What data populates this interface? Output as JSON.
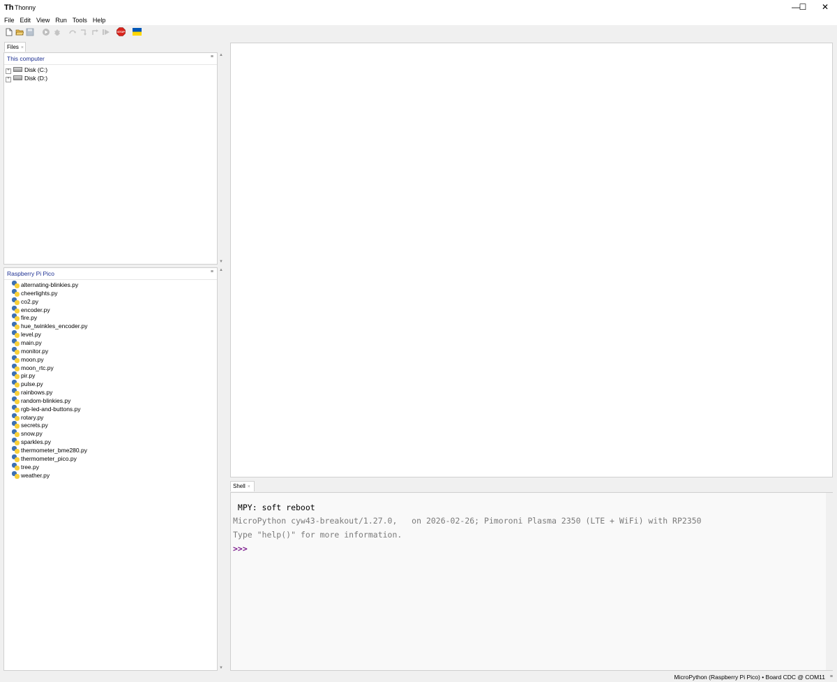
{
  "window": {
    "title": "Thonny",
    "app_icon": "Th",
    "controls": {
      "minimize": "—",
      "maximize": "☐",
      "close": "✕"
    }
  },
  "menubar": [
    "File",
    "Edit",
    "View",
    "Run",
    "Tools",
    "Help"
  ],
  "toolbar": {
    "icons": [
      "new-file-icon",
      "open-file-icon",
      "save-file-icon",
      "run-icon",
      "debug-icon",
      "step-over-icon",
      "step-into-icon",
      "step-out-icon",
      "resume-icon",
      "stop-icon",
      "ukraine-flag-icon"
    ],
    "stop_label": "STOP",
    "stop_color": "#d9241c",
    "flag_colors": [
      "#0057b7",
      "#ffd700"
    ]
  },
  "files_panel": {
    "tab_label": "Files",
    "close_glyph": "×",
    "menu_glyph": "≡",
    "this_computer": {
      "title": "This computer",
      "drives": [
        "Disk (C:)",
        "Disk (D:)"
      ]
    },
    "device": {
      "title": "Raspberry Pi Pico",
      "files": [
        "alternating-blinkies.py",
        "cheerlights.py",
        "co2.py",
        "encoder.py",
        "fire.py",
        "hue_twinkles_encoder.py",
        "level.py",
        "main.py",
        "monitor.py",
        "moon.py",
        "moon_rtc.py",
        "pir.py",
        "pulse.py",
        "rainbows.py",
        "random-blinkies.py",
        "rgb-led-and-buttons.py",
        "rotary.py",
        "secrets.py",
        "snow.py",
        "sparkles.py",
        "thermometer_bme280.py",
        "thermometer_pico.py",
        "tree.py",
        "weather.py"
      ]
    }
  },
  "shell": {
    "tab_label": "Shell",
    "close_glyph": "×",
    "lines": [
      " MPY: soft reboot",
      "MicroPython cyw43-breakout/1.27.0,   on 2026-02-26; Pimoroni Plasma 2350 (LTE + WiFi) with RP2350",
      "Type \"help()\" for more information."
    ],
    "prompt": ">>>"
  },
  "statusbar": {
    "text": "MicroPython (Raspberry Pi Pico)  •  Board CDC @ COM11",
    "menu_glyph": "≡"
  },
  "colors": {
    "panel_title": "#1c2f92",
    "prompt": "#7b1a8c",
    "shell_info": "#7a7a7a"
  }
}
